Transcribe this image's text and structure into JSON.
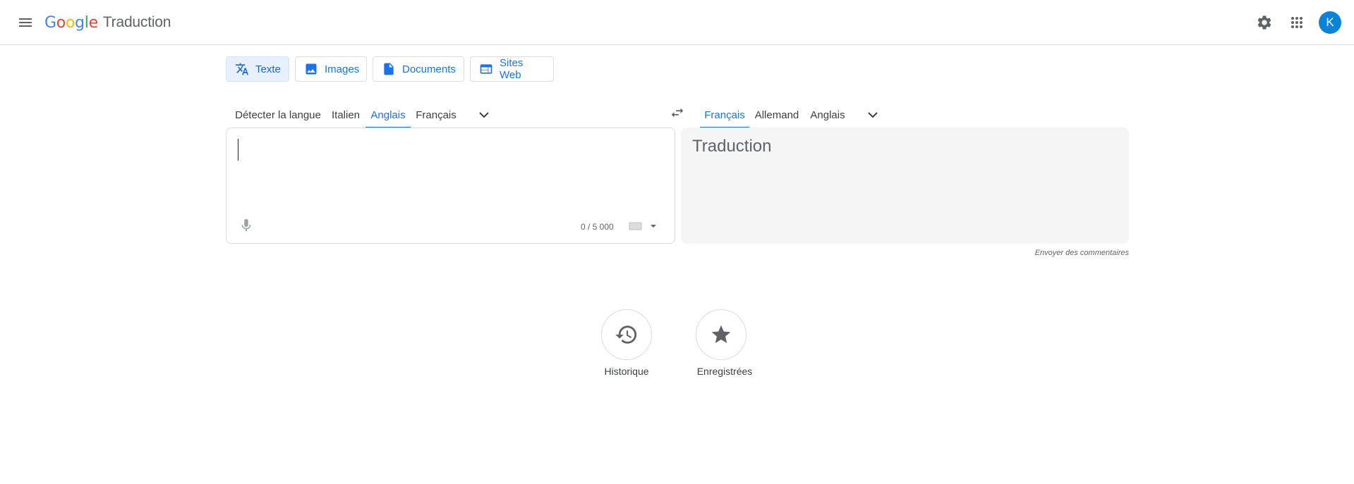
{
  "header": {
    "logo_letters": [
      "G",
      "o",
      "o",
      "g",
      "l",
      "e"
    ],
    "product": "Traduction",
    "avatar_initial": "K"
  },
  "modes": [
    {
      "label": "Texte",
      "icon": "translate-icon",
      "active": true
    },
    {
      "label": "Images",
      "icon": "image-icon",
      "active": false
    },
    {
      "label": "Documents",
      "icon": "document-icon",
      "active": false
    },
    {
      "label": "Sites Web",
      "icon": "website-icon",
      "active": false
    }
  ],
  "source_languages": [
    "Détecter la langue",
    "Italien",
    "Anglais",
    "Français"
  ],
  "source_active": "Anglais",
  "target_languages": [
    "Français",
    "Allemand",
    "Anglais"
  ],
  "target_active": "Français",
  "source": {
    "value": "",
    "counter": "0 / 5 000"
  },
  "target": {
    "placeholder": "Traduction"
  },
  "feedback": "Envoyer des commentaires",
  "history_label": "Historique",
  "saved_label": "Enregistrées",
  "colors": {
    "accent": "#1a73e8",
    "avatar": "#0b84d6",
    "google_blue": "#4285f4",
    "google_red": "#ea4335",
    "google_yellow": "#fbbc05",
    "google_green": "#34a853"
  }
}
